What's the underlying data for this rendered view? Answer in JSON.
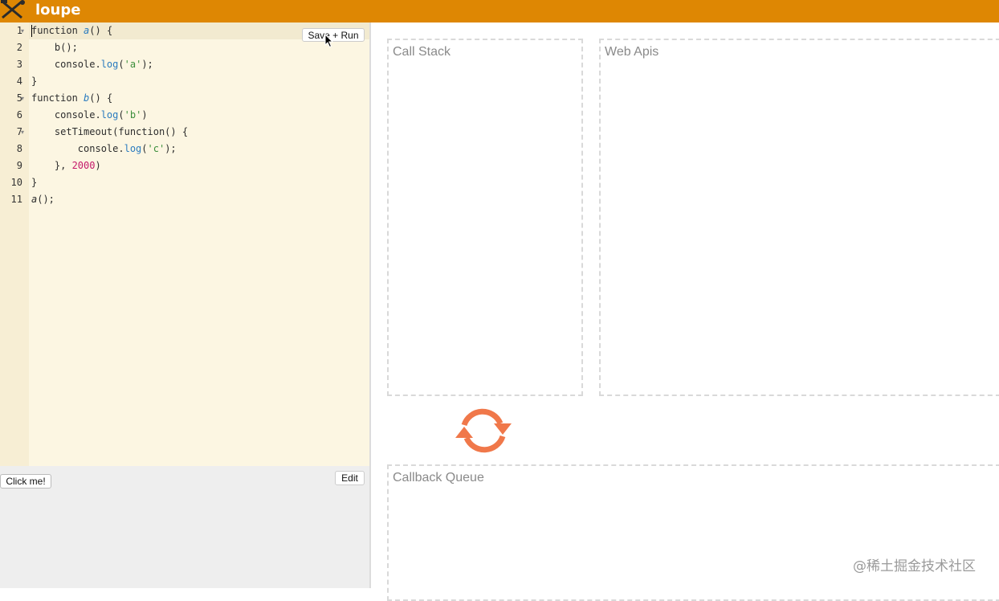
{
  "header": {
    "title": "loupe"
  },
  "editor": {
    "line_numbers": [
      "1",
      "2",
      "3",
      "4",
      "5",
      "6",
      "7",
      "8",
      "9",
      "10",
      "11"
    ],
    "save_run_label": "Save + Run",
    "code": {
      "l1": {
        "kw": "function ",
        "name": "a",
        "rest": "() {"
      },
      "l2": {
        "text": "    b();"
      },
      "l3": {
        "indent": "    console.",
        "prop": "log",
        "open": "(",
        "str": "'a'",
        "close": ");"
      },
      "l4": {
        "text": "}"
      },
      "l5": {
        "kw": "function ",
        "name": "b",
        "rest": "() {"
      },
      "l6": {
        "indent": "    console.",
        "prop": "log",
        "open": "(",
        "str": "'b'",
        "close": ")"
      },
      "l7": {
        "text": "    setTimeout(function() {"
      },
      "l8": {
        "indent": "        console.",
        "prop": "log",
        "open": "(",
        "str": "'c'",
        "close": ");"
      },
      "l9": {
        "pre": "    }, ",
        "num": "2000",
        "post": ")"
      },
      "l10": {
        "text": "}"
      },
      "l11": {
        "name": "a",
        "rest": "();"
      }
    }
  },
  "html_panel": {
    "click_me_label": "Click me!",
    "edit_label": "Edit"
  },
  "visualizer": {
    "call_stack_label": "Call Stack",
    "web_apis_label": "Web Apis",
    "callback_queue_label": "Callback Queue"
  },
  "watermark": "@稀土掘金技术社区",
  "colors": {
    "accent": "#de8703",
    "event_loop": "#f0784a"
  }
}
